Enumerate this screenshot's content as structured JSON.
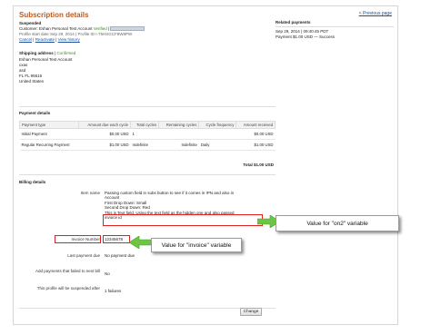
{
  "header": {
    "title": "Subscription details",
    "back_link": "< Previous page"
  },
  "status": {
    "value": "Suspended",
    "customer_label": "Customer:",
    "customer_name": "Eshan Personal Test Account",
    "verified": "Verified",
    "profile_line": "Profile start date Sep 29, 2014 | Profile ID I-75HSGCF8W8PW",
    "actions": [
      "Cancel",
      "Reactivate",
      "View history"
    ]
  },
  "related": {
    "title": "Related payments",
    "line1": "Sep 29, 2014 | 09:40:45 PDT",
    "line2": "Payment $1.00 USD — Success"
  },
  "shipping": {
    "title": "Shipping address",
    "confirmed": "Confirmed",
    "lines": [
      "Eshan Personal Test Account",
      "cxas",
      "asd",
      "FL FL 95616",
      "United States"
    ]
  },
  "payment": {
    "title": "Payment details",
    "columns": [
      "Payment type",
      "Amount due each cycle",
      "Total cycles",
      "Remaining cycles",
      "Cycle frequency",
      "Amount received"
    ],
    "rows": [
      [
        "Initial Payment",
        "$0.00 USD",
        "1",
        "",
        "",
        "$0.00 USD"
      ],
      [
        "Regular Recurring Payment",
        "$1.00 USD",
        "Indefinite",
        "Indefinite",
        "Daily",
        "$1.00 USD"
      ]
    ],
    "total": "Total $1.00 USD"
  },
  "billing": {
    "title": "Billing details",
    "item_name_label": "Item name",
    "item_name_lines": [
      "Passing custom field in subs button to see if it comes in IPN and also in",
      "Account",
      "First Drop Down: Small",
      "Second Drop Down: Red",
      "This is Text field. Using the text field as the hidden one and also passed",
      "invoice id"
    ],
    "invoice_label": "Invoice Number",
    "invoice_value": "12345678",
    "last_payment_label": "Last payment due",
    "last_payment_value": "No payment due",
    "add_failed_label": "Add payments that failed to next bill",
    "add_failed_value": "No",
    "suspend_label": "This profile will be suspended after",
    "suspend_value": "1 failures"
  },
  "callouts": {
    "on2": "Value for \"on2\" variable",
    "invoice": "Value for \"invoice\" variable"
  },
  "buttons": {
    "change": "Change"
  },
  "colors": {
    "title": "#c0591b",
    "green": "#3a8a1f",
    "link": "#1a4f9c",
    "arrow": "#6cc644",
    "highlight": "#e02020"
  }
}
